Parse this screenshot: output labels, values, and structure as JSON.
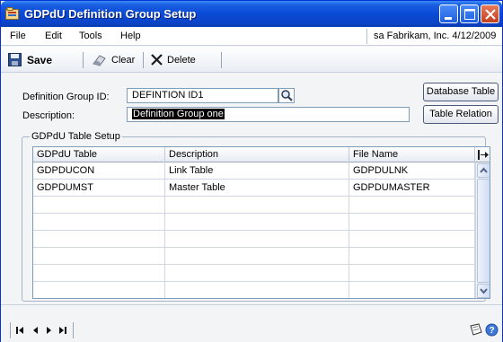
{
  "window": {
    "title": "GDPdU Definition Group Setup"
  },
  "menu": {
    "items": [
      "File",
      "Edit",
      "Tools",
      "Help"
    ],
    "company_info": "sa  Fabrikam, Inc.  4/12/2009"
  },
  "toolbar": {
    "save_label": "Save",
    "clear_label": "Clear",
    "delete_label": "Delete"
  },
  "form": {
    "group_id_label": "Definition Group ID:",
    "group_id_value": "DEFINTION ID1",
    "description_label": "Description:",
    "description_value": "Definition Group one",
    "database_table_label": "Database Table",
    "table_relation_label": "Table Relation"
  },
  "table_setup": {
    "group_title": "GDPdU Table Setup",
    "columns": [
      "GDPdU Table",
      "Description",
      "File Name"
    ],
    "rows": [
      [
        "GDPDUCON",
        "Link Table",
        "GDPDULNK"
      ],
      [
        "GDPDUMST",
        "Master Table",
        "GDPDUMASTER"
      ],
      [
        "",
        "",
        ""
      ],
      [
        "",
        "",
        ""
      ],
      [
        "",
        "",
        ""
      ],
      [
        "",
        "",
        ""
      ],
      [
        "",
        "",
        ""
      ],
      [
        "",
        "",
        ""
      ]
    ]
  },
  "colors": {
    "titlebar": "#0a4ad6",
    "window_bg": "#f3f4f6",
    "selection": "#000000"
  }
}
